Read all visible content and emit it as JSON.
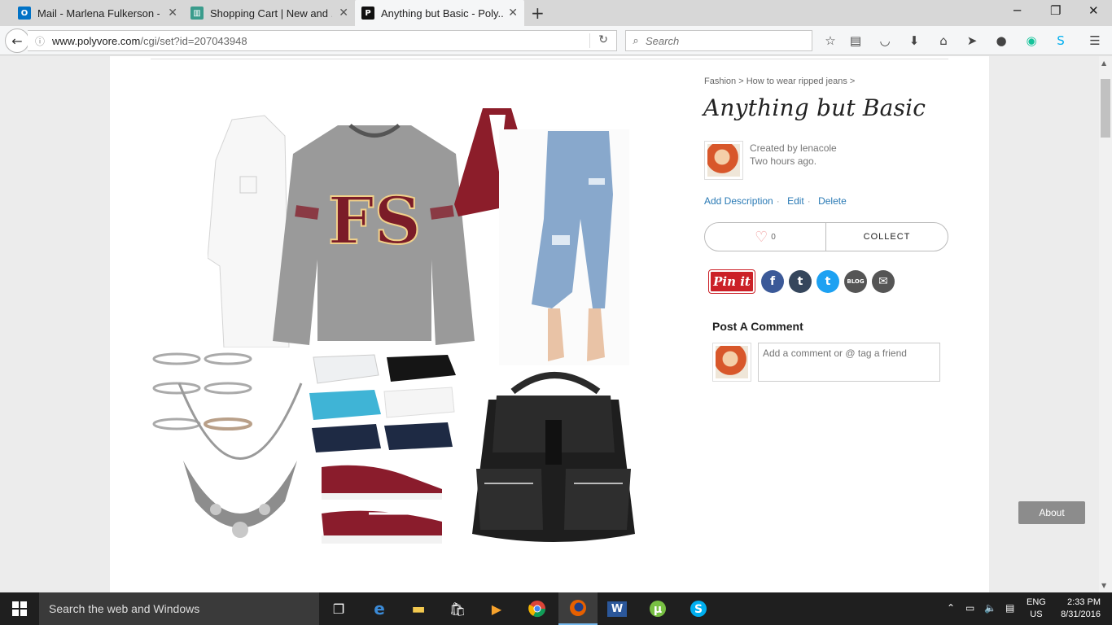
{
  "tabs": [
    {
      "title": "Mail - Marlena Fulkerson -...",
      "icon": "outlook-icon",
      "active": false
    },
    {
      "title": "Shopping Cart | New and ...",
      "icon": "shop-icon",
      "active": false
    },
    {
      "title": "Anything but Basic - Poly...",
      "icon": "polyvore-icon",
      "active": true
    }
  ],
  "browser": {
    "url_host": "www.polyvore.com",
    "url_path": "/cgi/set?id=207043948",
    "search_placeholder": "Search"
  },
  "page": {
    "breadcrumb": [
      "Fashion",
      ">",
      "How to wear ripped jeans",
      ">"
    ],
    "title": "Anything but Basic",
    "created_by": "Created by lenacole",
    "created_when": "Two hours ago.",
    "actions": {
      "add_description": "Add Description",
      "edit": "Edit",
      "delete": "Delete",
      "separator": "·"
    },
    "like_count": "0",
    "collect_label": "COLLECT",
    "share": {
      "pinit": "Pin it",
      "facebook": "f",
      "tumblr": "t",
      "twitter": "t",
      "blog": "BLOG",
      "email": "✉"
    },
    "post_comment_label": "Post A Comment",
    "comment_placeholder": "Add a comment or @ tag a friend",
    "about_label": "About"
  },
  "collage_items": [
    {
      "name": "white-shirt-item",
      "color": "#f4f4f4"
    },
    {
      "name": "fsu-sweatshirt-item",
      "color": "#8f8f8f"
    },
    {
      "name": "burgundy-bralette-item",
      "color": "#8c1d2a"
    },
    {
      "name": "ripped-jeans-item",
      "color": "#8faecf"
    },
    {
      "name": "rings-item",
      "color": "#b9b9b9"
    },
    {
      "name": "statement-necklace-item",
      "color": "#9a9a9a"
    },
    {
      "name": "novelty-socks-item",
      "color": "#2a3242"
    },
    {
      "name": "burgundy-sneakers-item",
      "color": "#8a1c2c"
    },
    {
      "name": "black-backpack-item",
      "color": "#1f1f1f"
    }
  ],
  "taskbar": {
    "search_text": "Search the web and Windows",
    "lang_top": "ENG",
    "lang_bottom": "US",
    "time": "2:33 PM",
    "date": "8/31/2016"
  }
}
